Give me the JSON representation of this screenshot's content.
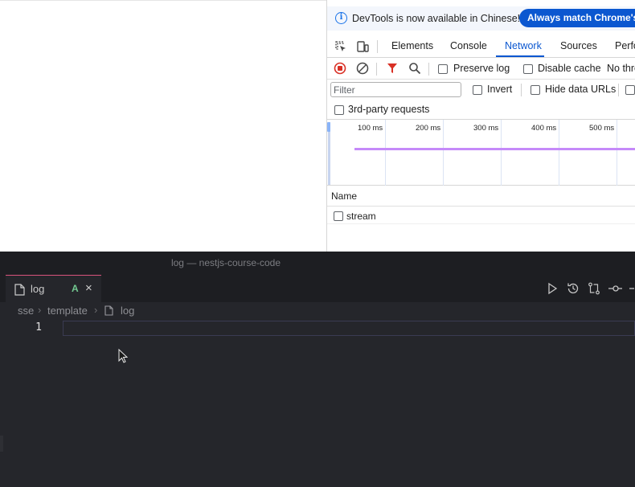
{
  "devtools": {
    "infobar": {
      "icon": "info-icon",
      "message": "DevTools is now available in Chinese!",
      "button_label": "Always match Chrome's la"
    },
    "tabs": [
      {
        "label": "Elements",
        "active": false
      },
      {
        "label": "Console",
        "active": false
      },
      {
        "label": "Network",
        "active": true
      },
      {
        "label": "Sources",
        "active": false
      },
      {
        "label": "Perfo",
        "active": false
      }
    ],
    "toolbar": {
      "preserve_log": "Preserve log",
      "disable_cache": "Disable cache",
      "throttle": "No thro"
    },
    "filter": {
      "placeholder": "Filter",
      "invert": "Invert",
      "hide_data_urls": "Hide data URLs"
    },
    "third_party": "3rd-party requests",
    "timeline": {
      "ticks": [
        "100 ms",
        "200 ms",
        "300 ms",
        "400 ms",
        "500 ms"
      ]
    },
    "table": {
      "name_header": "Name",
      "rows": [
        {
          "name": "stream"
        }
      ]
    },
    "accent_color": "#0b57d0"
  },
  "editor": {
    "window_title": "log — nestjs-course-code",
    "tab": {
      "label": "log",
      "status": "A",
      "close": "×"
    },
    "breadcrumb": [
      "sse",
      "template",
      "log"
    ],
    "line_number": "1"
  }
}
